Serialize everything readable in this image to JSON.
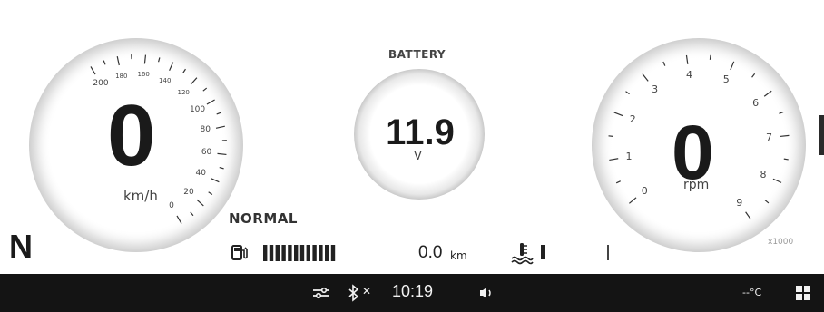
{
  "speed": {
    "value": "0",
    "unit": "km/h",
    "ticks": [
      "0",
      "20",
      "40",
      "60",
      "80",
      "100",
      "120",
      "140",
      "160",
      "180",
      "200"
    ]
  },
  "gear": "N",
  "battery": {
    "title": "BATTERY",
    "value": "11.9",
    "unit": "V"
  },
  "mode": "NORMAL",
  "fuel": {
    "icon": "fuel-pump-icon",
    "level": 1.0
  },
  "odometer": {
    "value": "0.0",
    "unit": "km"
  },
  "coolant": {
    "icon": "coolant-temp-icon"
  },
  "tach": {
    "value": "0",
    "unit": "rpm",
    "multiplier": "x1000",
    "ticks": [
      "0",
      "1",
      "2",
      "3",
      "4",
      "5",
      "6",
      "7",
      "8",
      "9"
    ]
  },
  "statusbar": {
    "time": "10:19",
    "bluetooth": "✕",
    "temperature": "--°C",
    "icons": [
      "connection-icon",
      "bluetooth-icon",
      "volume-icon",
      "menu-grid-icon"
    ]
  },
  "colors": {
    "background": "#ffffff",
    "bar": "#141414",
    "text": "#1a1a1a"
  }
}
